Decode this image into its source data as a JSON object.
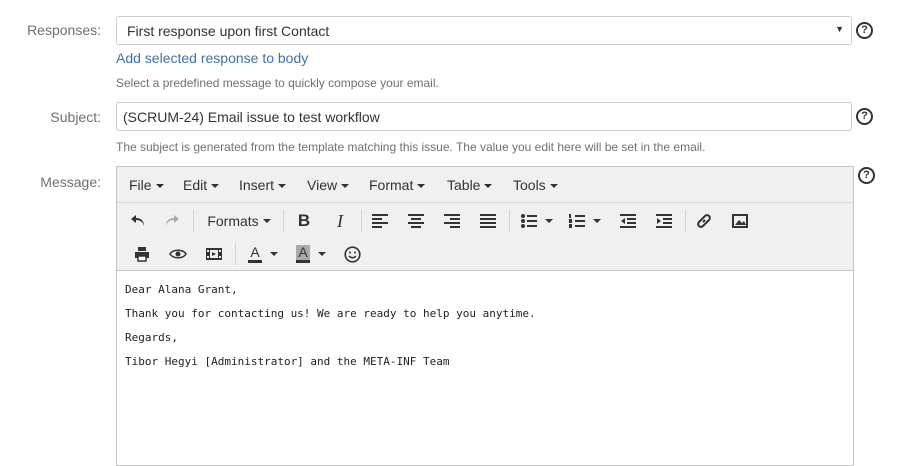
{
  "responses": {
    "label": "Responses:",
    "selected": "First response upon first Contact",
    "arrow": "▼",
    "add_link": "Add selected response to body",
    "hint": "Select a predefined message to quickly compose your email."
  },
  "subject": {
    "label": "Subject:",
    "value": "(SCRUM-24) Email issue to test workflow",
    "hint": "The subject is generated from the template matching this issue. The value you edit here will be set in the email."
  },
  "message": {
    "label": "Message:",
    "menu": [
      "File",
      "Edit",
      "Insert",
      "View",
      "Format",
      "Table",
      "Tools"
    ],
    "toolbar": {
      "formats_label": "Formats",
      "bold_label": "B",
      "italic_label": "I",
      "text_color_label": "A",
      "bg_color_label": "A"
    },
    "body_lines": [
      "Dear Alana Grant,",
      "Thank you for contacting us! We are ready to help you anytime.",
      "Regards,",
      "Tibor Hegyi [Administrator] and the META-INF Team"
    ]
  },
  "help_icon_symbol": "?",
  "icons": [
    "help-icon",
    "undo-icon",
    "redo-icon",
    "align-left-icon",
    "align-center-icon",
    "align-right-icon",
    "justify-icon",
    "bullet-list-icon",
    "numbered-list-icon",
    "outdent-icon",
    "indent-icon",
    "link-icon",
    "image-icon",
    "print-icon",
    "preview-icon",
    "media-icon",
    "emoticon-icon"
  ],
  "colors": {
    "link": "#3b73af",
    "label": "#707070",
    "toolbar_bg": "#f0f0f0"
  }
}
